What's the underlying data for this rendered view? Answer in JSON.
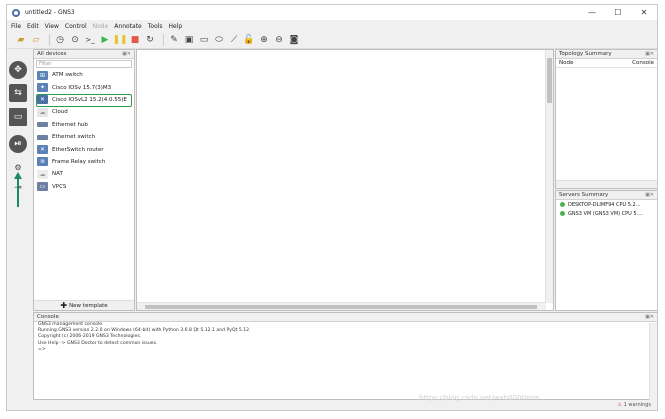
{
  "window": {
    "title": "untitled2 - GNS3",
    "minimize": "—",
    "maximize": "☐",
    "close": "✕"
  },
  "menu": [
    "File",
    "Edit",
    "View",
    "Control",
    "Node",
    "Annotate",
    "Tools",
    "Help"
  ],
  "menu_disabled": [
    4
  ],
  "devices_panel": {
    "title": "All devices",
    "filter_placeholder": "Filter",
    "items": [
      {
        "label": "ATM switch",
        "color": "#5b82b6"
      },
      {
        "label": "Cisco IOSv 15.7(3)M3",
        "color": "#5b82b6"
      },
      {
        "label": "Cisco IOSvL2 15.2(4.0.55)E",
        "color": "#4a6fa5"
      },
      {
        "label": "Cloud",
        "color": "#e0e0e0"
      },
      {
        "label": "Ethernet hub",
        "color": "#6d7fa3"
      },
      {
        "label": "Ethernet switch",
        "color": "#6d7fa3"
      },
      {
        "label": "EtherSwitch router",
        "color": "#5b82b6"
      },
      {
        "label": "Frame Relay switch",
        "color": "#5b82b6"
      },
      {
        "label": "NAT",
        "color": "#e8e8e8"
      },
      {
        "label": "VPCS",
        "color": "#6d7fa3"
      }
    ],
    "new_template": "New template"
  },
  "topology": {
    "title": "Topology Summary",
    "col_node": "Node",
    "col_console": "Console"
  },
  "servers": {
    "title": "Servers Summary",
    "items": [
      "DESKTOP-DLIMF94 CPU 5.2...",
      "GNS3 VM (GNS3 VM) CPU 5...."
    ]
  },
  "console": {
    "title": "Console",
    "lines": [
      "GNS3 management console.",
      "Running GNS3 version 2.2.0 on Windows (64-bit) with Python 3.6.8 Qt 5.12.1 and PyQt 5.12.",
      "Copyright (c) 2006-2019 GNS3 Technologies.",
      "Use Help -> GNS3 Doctor to detect common issues.",
      "",
      "=>"
    ]
  },
  "status": {
    "warnings": "1 warnings"
  },
  "watermark": "https://blog.csdn.net/wxh0000mm",
  "colors": {
    "highlight": "#2c9b4e",
    "arrow": "#1a8a6a"
  }
}
